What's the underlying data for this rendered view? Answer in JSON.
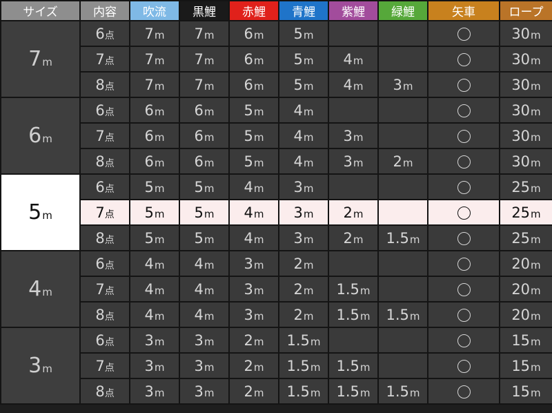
{
  "headers": [
    {
      "key": "size",
      "label": "サイズ",
      "bg": "#8e8e8e"
    },
    {
      "key": "content",
      "label": "内容",
      "bg": "#8e8e8e"
    },
    {
      "key": "fukinagashi",
      "label": "吹流",
      "bg": "#7fb9e6"
    },
    {
      "key": "black",
      "label": "黒鯉",
      "bg": "#1a1a1a"
    },
    {
      "key": "red",
      "label": "赤鯉",
      "bg": "#e0211b"
    },
    {
      "key": "blue",
      "label": "青鯉",
      "bg": "#1f74c9"
    },
    {
      "key": "purple",
      "label": "紫鯉",
      "bg": "#a24c9c"
    },
    {
      "key": "green",
      "label": "緑鯉",
      "bg": "#56a83a"
    },
    {
      "key": "yaguruma",
      "label": "矢車",
      "bg": "#c8811e"
    },
    {
      "key": "rope",
      "label": "ロープ",
      "bg": "#ba7428"
    }
  ],
  "unit_m": "m",
  "unit_ten": "点",
  "circle": "○",
  "groups": [
    {
      "size": "7",
      "active": false,
      "rows": [
        {
          "content": "6",
          "fukinagashi": "7",
          "black": "7",
          "red": "6",
          "blue": "5",
          "purple": "",
          "green": "",
          "yaguruma": true,
          "rope": "30"
        },
        {
          "content": "7",
          "fukinagashi": "7",
          "black": "7",
          "red": "6",
          "blue": "5",
          "purple": "4",
          "green": "",
          "yaguruma": true,
          "rope": "30"
        },
        {
          "content": "8",
          "fukinagashi": "7",
          "black": "7",
          "red": "6",
          "blue": "5",
          "purple": "4",
          "green": "3",
          "yaguruma": true,
          "rope": "30"
        }
      ]
    },
    {
      "size": "6",
      "active": false,
      "rows": [
        {
          "content": "6",
          "fukinagashi": "6",
          "black": "6",
          "red": "5",
          "blue": "4",
          "purple": "",
          "green": "",
          "yaguruma": true,
          "rope": "30"
        },
        {
          "content": "7",
          "fukinagashi": "6",
          "black": "6",
          "red": "5",
          "blue": "4",
          "purple": "3",
          "green": "",
          "yaguruma": true,
          "rope": "30"
        },
        {
          "content": "8",
          "fukinagashi": "6",
          "black": "6",
          "red": "5",
          "blue": "4",
          "purple": "3",
          "green": "2",
          "yaguruma": true,
          "rope": "30"
        }
      ]
    },
    {
      "size": "5",
      "active": true,
      "rows": [
        {
          "content": "6",
          "fukinagashi": "5",
          "black": "5",
          "red": "4",
          "blue": "3",
          "purple": "",
          "green": "",
          "yaguruma": true,
          "rope": "25",
          "active": false
        },
        {
          "content": "7",
          "fukinagashi": "5",
          "black": "5",
          "red": "4",
          "blue": "3",
          "purple": "2",
          "green": "",
          "yaguruma": true,
          "rope": "25",
          "active": true
        },
        {
          "content": "8",
          "fukinagashi": "5",
          "black": "5",
          "red": "4",
          "blue": "3",
          "purple": "2",
          "green": "1.5",
          "yaguruma": true,
          "rope": "25",
          "active": false
        }
      ]
    },
    {
      "size": "4",
      "active": false,
      "rows": [
        {
          "content": "6",
          "fukinagashi": "4",
          "black": "4",
          "red": "3",
          "blue": "2",
          "purple": "",
          "green": "",
          "yaguruma": true,
          "rope": "20"
        },
        {
          "content": "7",
          "fukinagashi": "4",
          "black": "4",
          "red": "3",
          "blue": "2",
          "purple": "1.5",
          "green": "",
          "yaguruma": true,
          "rope": "20"
        },
        {
          "content": "8",
          "fukinagashi": "4",
          "black": "4",
          "red": "3",
          "blue": "2",
          "purple": "1.5",
          "green": "1.5",
          "yaguruma": true,
          "rope": "20"
        }
      ]
    },
    {
      "size": "3",
      "active": false,
      "rows": [
        {
          "content": "6",
          "fukinagashi": "3",
          "black": "3",
          "red": "2",
          "blue": "1.5",
          "purple": "",
          "green": "",
          "yaguruma": true,
          "rope": "15"
        },
        {
          "content": "7",
          "fukinagashi": "3",
          "black": "3",
          "red": "2",
          "blue": "1.5",
          "purple": "1.5",
          "green": "",
          "yaguruma": true,
          "rope": "15"
        },
        {
          "content": "8",
          "fukinagashi": "3",
          "black": "3",
          "red": "2",
          "blue": "1.5",
          "purple": "1.5",
          "green": "1.5",
          "yaguruma": true,
          "rope": "15"
        }
      ]
    }
  ]
}
